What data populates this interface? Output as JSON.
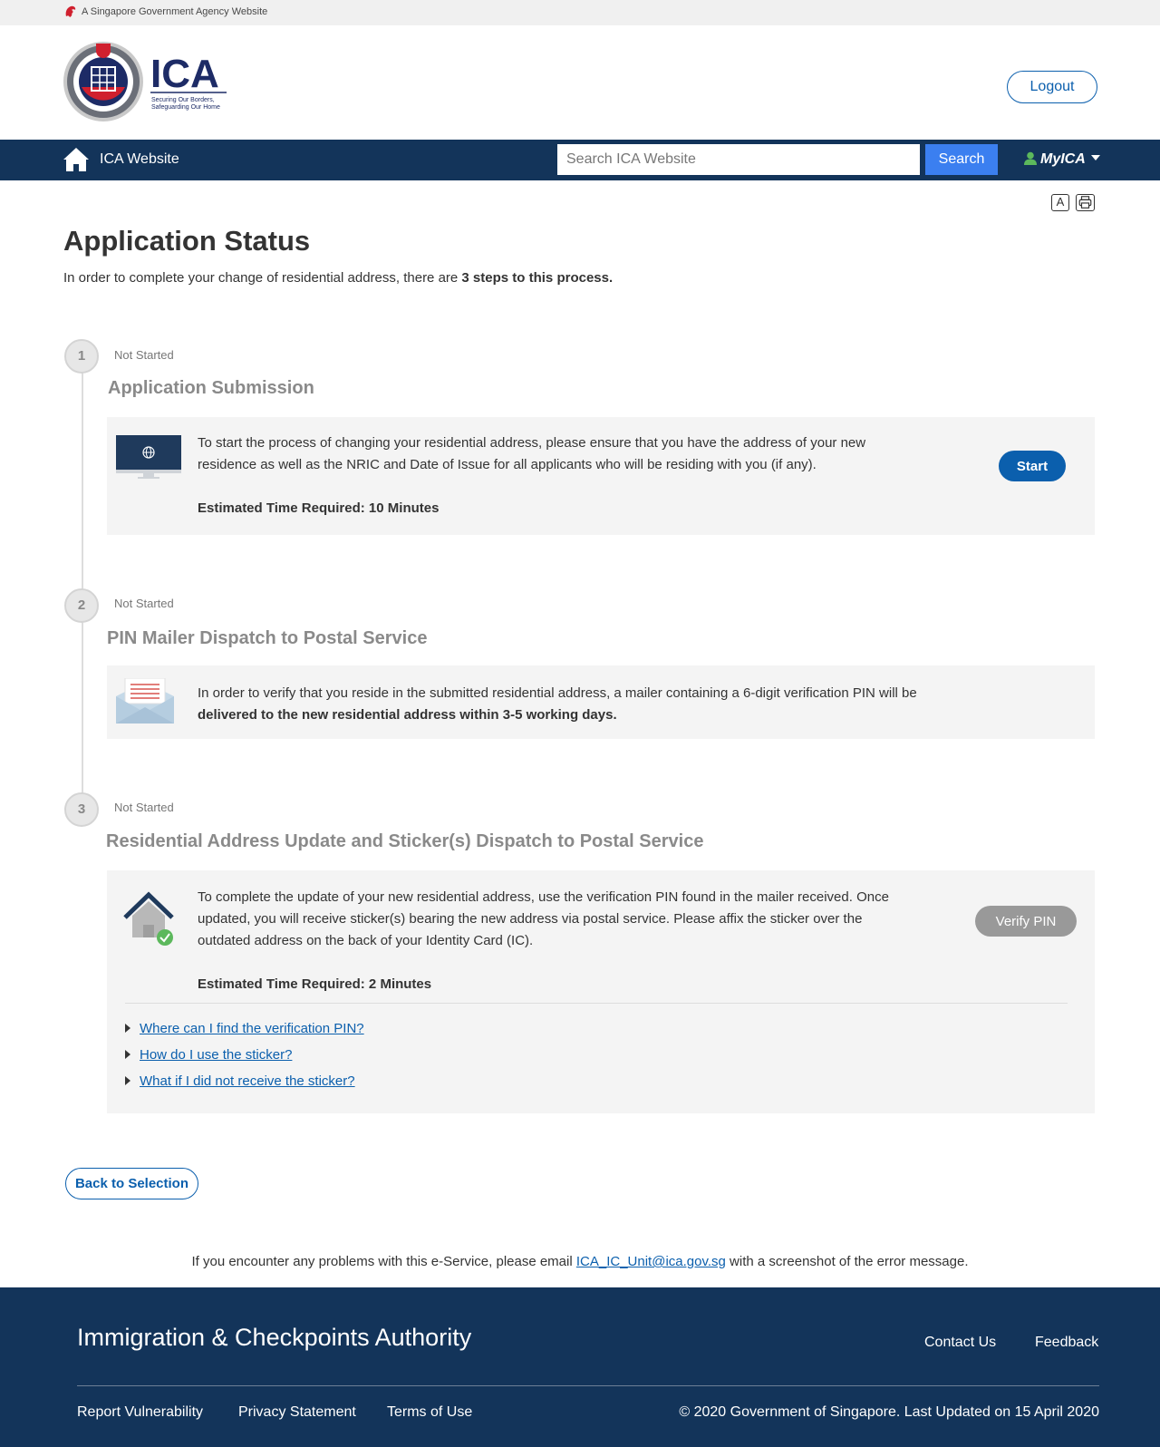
{
  "masthead": {
    "text": "A Singapore Government Agency Website",
    "lion_icon": "lion-head-icon"
  },
  "header": {
    "logo": {
      "name": "ICA",
      "tagline_line1": "Securing Our Borders,",
      "tagline_line2": "Safeguarding Our Home",
      "crest_icon": "ica-crest-icon"
    },
    "logout_label": "Logout"
  },
  "nav": {
    "home_icon": "home-icon",
    "title": "ICA Website",
    "search_placeholder": "Search ICA Website",
    "search_label": "Search",
    "myica_label": "MyICA",
    "colors": {
      "bar": "#13345a",
      "search_button": "#3b7ff0",
      "user_icon": "#5cb85c"
    }
  },
  "tools": {
    "font_size_label": "A",
    "print_icon": "printer-icon"
  },
  "page": {
    "title": "Application Status",
    "intro_prefix": "In order to complete your change of residential address, there are ",
    "intro_bold": "3 steps to this process."
  },
  "steps": [
    {
      "number": "1",
      "status": "Not Started",
      "title": "Application Submission",
      "icon": "monitor-globe-icon",
      "text": "To start the process of changing your residential address, please ensure that you have the address of your new residence as well as the NRIC and Date of Issue for all applicants who will be residing with you (if any).",
      "estimate": "Estimated Time Required: 10 Minutes",
      "button_label": "Start"
    },
    {
      "number": "2",
      "status": "Not Started",
      "title": "PIN Mailer Dispatch to Postal Service",
      "icon": "open-envelope-icon",
      "text_prefix": "In order to verify that you reside in the submitted residential address, a mailer containing a 6-digit verification PIN will be ",
      "text_bold": "delivered to the new residential address within 3-5 working days."
    },
    {
      "number": "3",
      "status": "Not Started",
      "title": "Residential Address Update and Sticker(s) Dispatch to Postal Service",
      "icon": "house-check-icon",
      "text": "To complete the update of your new residential address, use the verification PIN found in the mailer received. Once updated, you will receive sticker(s) bearing the new address via postal service. Please affix the sticker over the outdated address on the back of your Identity Card (IC).",
      "estimate": "Estimated Time Required: 2 Minutes",
      "button_label": "Verify PIN",
      "faqs": [
        "Where can I find the verification PIN?",
        "How do I use the sticker?",
        "What if I did not receive the sticker?"
      ]
    }
  ],
  "back_label": "Back to Selection",
  "contact": {
    "prefix": "If you encounter any problems with this e-Service, please email ",
    "email": "ICA_IC_Unit@ica.gov.sg",
    "suffix": " with a screenshot of the error message."
  },
  "footer": {
    "title": "Immigration & Checkpoints Authority",
    "contact_us": "Contact Us",
    "feedback": "Feedback",
    "links": [
      "Report Vulnerability",
      "Privacy Statement",
      "Terms of Use"
    ],
    "copyright": "© 2020 Government of Singapore. Last Updated on 15 April 2020"
  }
}
